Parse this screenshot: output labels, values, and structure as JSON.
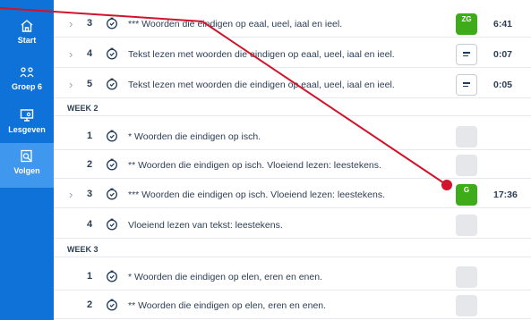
{
  "sidebar": {
    "items": [
      {
        "label": "Start",
        "icon": "home-icon",
        "active": false
      },
      {
        "label": "Groep 6",
        "icon": "group-icon",
        "active": false
      },
      {
        "label": "Lesgeven",
        "icon": "teach-icon",
        "active": false
      },
      {
        "label": "Volgen",
        "icon": "monitor-icon",
        "active": true
      }
    ]
  },
  "rows": [
    {
      "chevron": "›",
      "num": "3",
      "title": "*** Woorden die eindigen op eaal, ueel, iaal en ieel.",
      "badge": "green",
      "badge_text": "ZG",
      "time": "6:41"
    },
    {
      "chevron": "›",
      "num": "4",
      "title": "Tekst lezen met woorden die eindigen op eaal, ueel, iaal en ieel.",
      "badge": "doc",
      "badge_text": "",
      "time": "0:07"
    },
    {
      "chevron": "›",
      "num": "5",
      "title": "Tekst lezen met woorden die eindigen op eaal, ueel, iaal en ieel.",
      "badge": "doc",
      "badge_text": "",
      "time": "0:05"
    }
  ],
  "weeks": [
    {
      "label": "WEEK 2",
      "rows": [
        {
          "chevron": "",
          "num": "1",
          "title": "* Woorden die eindigen op isch.",
          "badge": "grey",
          "badge_text": "",
          "time": ""
        },
        {
          "chevron": "",
          "num": "2",
          "title": "** Woorden die eindigen op isch. Vloeiend lezen: leestekens.",
          "badge": "grey",
          "badge_text": "",
          "time": ""
        },
        {
          "chevron": "›",
          "num": "3",
          "title": "*** Woorden die eindigen op isch. Vloeiend lezen: leestekens.",
          "badge": "green",
          "badge_text": "G",
          "time": "17:36"
        },
        {
          "chevron": "",
          "num": "4",
          "title": "Vloeiend lezen van tekst: leestekens.",
          "badge": "grey",
          "badge_text": "",
          "time": ""
        }
      ]
    },
    {
      "label": "WEEK 3",
      "rows": [
        {
          "chevron": "",
          "num": "1",
          "title": "* Woorden die eindigen op elen, eren en enen.",
          "badge": "grey",
          "badge_text": "",
          "time": ""
        },
        {
          "chevron": "",
          "num": "2",
          "title": "** Woorden die eindigen op elen, eren en enen.",
          "badge": "grey",
          "badge_text": "",
          "time": ""
        }
      ]
    }
  ],
  "colors": {
    "sidebar": "#0e72d8",
    "sidebar_active": "#3f97ee",
    "badge_green": "#3dac18",
    "drag_line": "#d0142c"
  }
}
